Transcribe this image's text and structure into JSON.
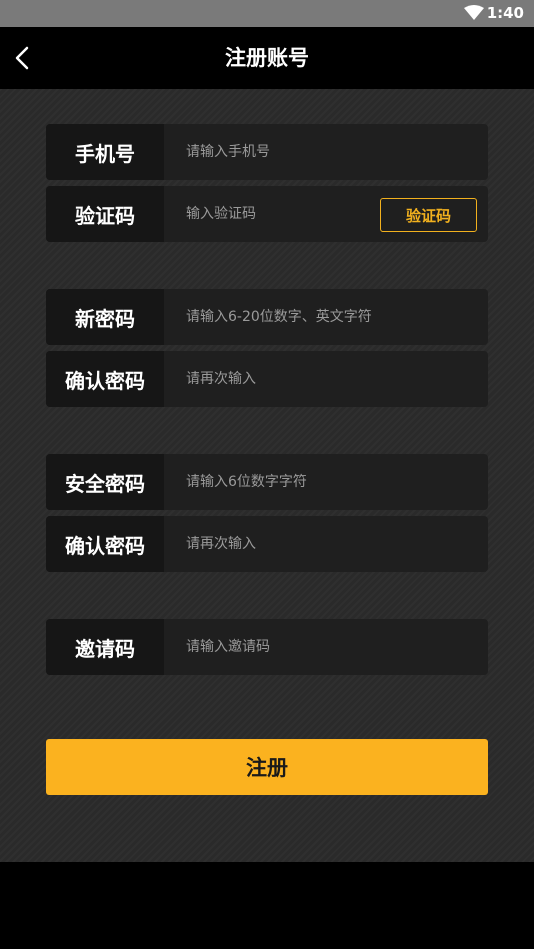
{
  "status_bar": {
    "time": "1:40",
    "wifi_icon": "wifi-icon"
  },
  "header": {
    "title": "注册账号",
    "back_icon": "chevron-left-icon"
  },
  "form": {
    "phone": {
      "label": "手机号",
      "placeholder": "请输入手机号",
      "value": ""
    },
    "verify": {
      "label": "验证码",
      "placeholder": "输入验证码",
      "value": "",
      "button": "验证码"
    },
    "new_password": {
      "label": "新密码",
      "placeholder": "请输入6-20位数字、英文字符",
      "value": ""
    },
    "confirm_password": {
      "label": "确认密码",
      "placeholder": "请再次输入",
      "value": ""
    },
    "security_password": {
      "label": "安全密码",
      "placeholder": "请输入6位数字字符",
      "value": ""
    },
    "confirm_security": {
      "label": "确认密码",
      "placeholder": "请再次输入",
      "value": ""
    },
    "invite": {
      "label": "邀请码",
      "placeholder": "请输入邀请码",
      "value": ""
    },
    "submit": "注册"
  },
  "colors": {
    "accent": "#fbb21f",
    "background": "#2a2a2a"
  }
}
